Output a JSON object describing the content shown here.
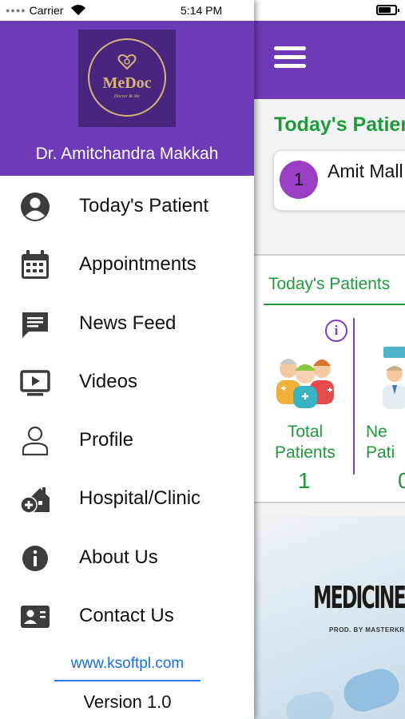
{
  "status_bar": {
    "carrier": "Carrier",
    "time": "5:14 PM"
  },
  "drawer": {
    "logo": {
      "text": "MeDoc",
      "tagline": "Doctor & Me"
    },
    "doctor_name": "Dr. Amitchandra Makkah",
    "menu": [
      {
        "label": "Today's Patient",
        "icon": "person-circle-icon"
      },
      {
        "label": "Appointments",
        "icon": "calendar-icon"
      },
      {
        "label": "News Feed",
        "icon": "message-icon"
      },
      {
        "label": "Videos",
        "icon": "video-icon"
      },
      {
        "label": "Profile",
        "icon": "person-outline-icon"
      },
      {
        "label": "Hospital/Clinic",
        "icon": "hospital-icon"
      },
      {
        "label": "About Us",
        "icon": "info-icon"
      },
      {
        "label": "Contact Us",
        "icon": "contact-card-icon"
      }
    ],
    "website": "www.ksoftpl.com",
    "version": "Version 1.0"
  },
  "main": {
    "section_title": "Today's Patien",
    "patient": {
      "number": "1",
      "name": "Amit Mall"
    },
    "stats_title": "Today's Patients",
    "stats": [
      {
        "label_line1": "Total",
        "label_line2": "Patients",
        "value": "1"
      },
      {
        "label_line1": "Ne",
        "label_line2": "Pati",
        "value": "0"
      }
    ],
    "banner": {
      "title": "MEDICINE",
      "subtitle": "PROD. BY MASTERKRAFT"
    }
  },
  "colors": {
    "header_purple": "#6f3ab8",
    "accent_green": "#1f9a3a",
    "link_blue": "#1a6fe0",
    "logo_gold": "#d6b574",
    "badge_purple": "#9b3fc4"
  }
}
